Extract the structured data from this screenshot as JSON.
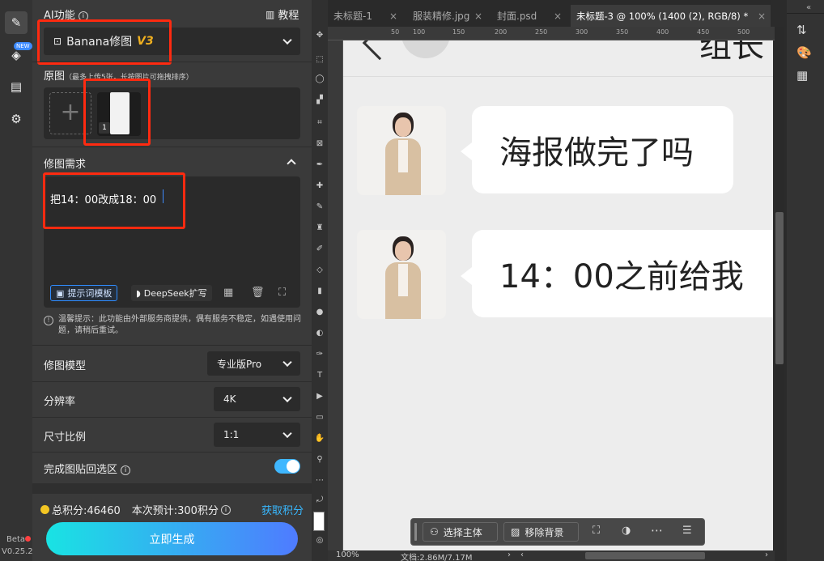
{
  "panel": {
    "ai_title": "AI功能",
    "tutorial": "教程",
    "model_select": "Banana修图",
    "model_version": "V3",
    "source_title": "原图",
    "source_hint": "（最多上传5张，长按图片可拖拽排序）",
    "thumb_index": "1",
    "req_title": "修图需求",
    "prompt_value": "把14：00改成18：00",
    "prompt_template": "提示词模板",
    "deepseek": "DeepSeek扩写",
    "tip": "温馨提示：此功能由外部服务商提供，偶有服务不稳定，如遇使用问题，请稍后重试。",
    "model_label": "修图模型",
    "model_value": "专业版Pro",
    "res_label": "分辨率",
    "res_value": "4K",
    "ratio_label": "尺寸比例",
    "ratio_value": "1:1",
    "paste_label": "完成图贴回选区",
    "paste_on": true,
    "points": "总积分:46460",
    "estimate": "本次预计:300积分",
    "get_points": "获取积分",
    "generate": "立即生成"
  },
  "rail": {
    "new_badge": "NEW",
    "beta": "Beta",
    "version": "V0.25.2"
  },
  "ps": {
    "tabs": [
      {
        "label": "未标题-1",
        "active": false
      },
      {
        "label": "服装精修.jpg",
        "active": false
      },
      {
        "label": "封面.psd",
        "active": false
      },
      {
        "label": "未标题-3 @ 100% (1400 (2), RGB/8) *",
        "active": true
      }
    ],
    "ruler_ticks": [
      "100",
      "150",
      "200",
      "250",
      "300",
      "350",
      "400",
      "450",
      "500"
    ],
    "ruler_first": "50",
    "zoom": "100%",
    "doc_info": "文档:2.86M/7.17M",
    "top_text": "组长"
  },
  "chat": {
    "msg1": "海报做完了吗",
    "msg2": "14：00之前给我"
  },
  "floatbar": {
    "select_subject": "选择主体",
    "remove_bg": "移除背景"
  },
  "colors": {
    "accent_red": "#ff2a10",
    "generate_start": "#19e3e3",
    "generate_end": "#4f7bff",
    "toggle": "#3fb7ff"
  }
}
